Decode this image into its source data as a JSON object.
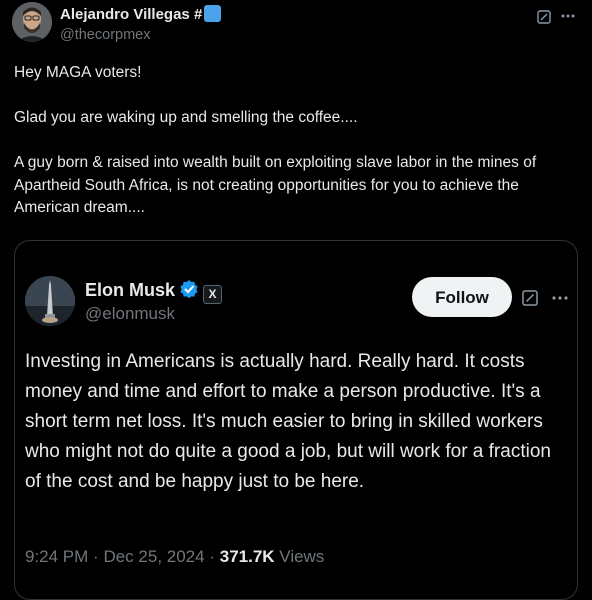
{
  "tweet": {
    "author_name": "Alejandro Villegas #",
    "author_handle": "@thecorpmex",
    "text_lines": [
      "Hey MAGA voters!",
      "Glad you are waking up and smelling the coffee....",
      "A guy born & raised into wealth built on exploiting slave labor in the mines of Apartheid South Africa, is not creating opportunities for you to achieve the American dream...."
    ],
    "icons": [
      "avatar",
      "verified-square-icon",
      "grok-icon",
      "more-icon"
    ]
  },
  "quoted": {
    "author_name": "Elon Musk",
    "author_handle": "@elonmusk",
    "x_badge": "X",
    "follow_label": "Follow",
    "text": "Investing in Americans is actually hard. Really hard. It costs money and time and effort to make a person productive. It's a short term net loss. It's much easier to bring in skilled workers who might not do quite a good a job, but will work for a fraction of the cost and be happy just to be here.",
    "time": "9:24 PM",
    "date": "Dec 25, 2024",
    "separator": "·",
    "views_count": "371.7K",
    "views_label": "Views",
    "colors": {
      "verified": "#1d9bf0",
      "follow_bg": "#eff3f4"
    },
    "icons": [
      "avatar",
      "verified-badge-icon",
      "x-affiliate-icon",
      "grok-icon",
      "more-icon"
    ]
  }
}
